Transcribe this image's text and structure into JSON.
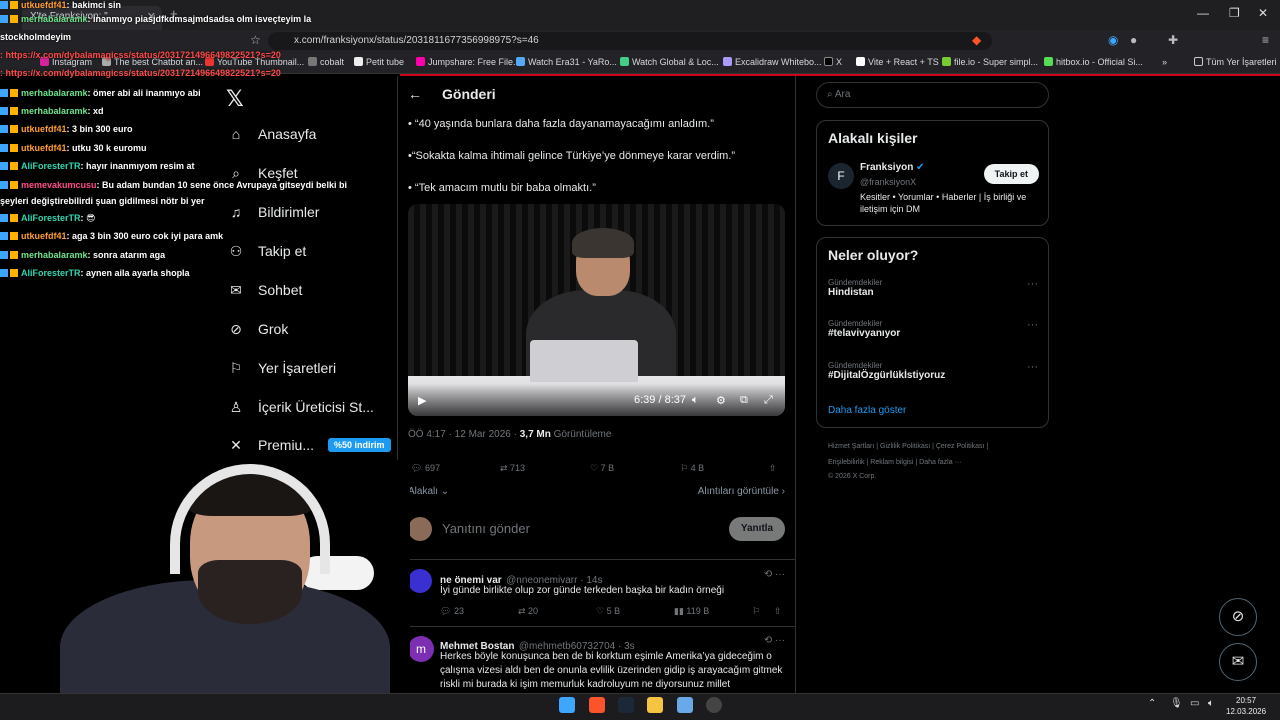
{
  "browser": {
    "tab_title": "X'te Franksiyon: \"",
    "tab_title2": "YouTuber Q",
    "url": "x.com/franksiyonx/status/2031811677356998975?s=46",
    "bookmarks": [
      "Instagram",
      "The best Chatbot an...",
      "YouTube Thumbnail...",
      "cobalt",
      "Petit tube",
      "Jumpshare: Free File...",
      "Watch Era31 - YaRo...",
      "Watch Global & Loc...",
      "Excalidraw Whitebo...",
      "X",
      "Vite + React + TS",
      "file.io - Super simpl...",
      "hitbox.io - Official Si...",
      "Tüm Yer İşaretleri"
    ]
  },
  "sidebar": {
    "items": [
      {
        "label": "Anasayfa",
        "icon": "home-icon"
      },
      {
        "label": "Keşfet",
        "icon": "search-icon"
      },
      {
        "label": "Bildirimler",
        "icon": "bell-icon"
      },
      {
        "label": "Takip et",
        "icon": "person-add-icon"
      },
      {
        "label": "Sohbet",
        "icon": "mail-icon"
      },
      {
        "label": "Grok",
        "icon": "grok-icon"
      },
      {
        "label": "Yer İşaretleri",
        "icon": "bookmark-icon"
      },
      {
        "label": "İçerik Üreticisi St...",
        "icon": "creator-icon"
      },
      {
        "label": "Premiu...",
        "icon": "x-icon"
      }
    ],
    "premium_badge": "%50 indirim"
  },
  "post": {
    "header": "Gönderi",
    "bullets": [
      "• “40 yaşında bunlara daha fazla dayanamayacağımı anladım.”",
      "•“Sokakta kalma ihtimali gelince Türkiye’ye dönmeye karar verdim.”",
      "• “Tek amacım mutlu bir baba olmaktı.”"
    ],
    "video_time": "6:39 / 8:37",
    "timestamp": "ÖÖ 4:17 · 12 Mar 2026 ·",
    "views": "3,7 Mn",
    "views_label": "Görüntüleme",
    "replies": "697",
    "reposts": "713",
    "likes": "7 B",
    "bookmarks": "4 B",
    "sort": "Alakalı",
    "quotes": "Alıntıları görüntüle",
    "reply_placeholder": "Yanıtını gönder",
    "reply_button": "Yanıtla"
  },
  "replies": [
    {
      "name": "ne önemi var",
      "handle": "@nneonemivarr · 14s",
      "text": "İyi günde birlikte olup zor günde terkeden başka bir kadın örneği",
      "r": "23",
      "rt": "20",
      "l": "5 B",
      "v": "119 B"
    },
    {
      "name": "Mehmet Bostan",
      "handle": "@mehmetb60732704 · 3s",
      "text": "Herkes böyle konuşunca ben de bi korktum eşimle Amerika’ya gideceğim o çalışma vizesi aldı ben de onunla evlilik üzerinden gidip iş arayacağım gitmek riskli mi burada ki işim memurluk kadroluyum ne diyorsunuz millet",
      "avatar_letter": "m"
    }
  ],
  "right": {
    "search_placeholder": "Ara",
    "relevant_title": "Alakalı kişiler",
    "person_name": "Franksiyon",
    "person_handle": "@franksiyonX",
    "person_bio": "Kesitler • Yorumlar • Haberler | İş birliği ve iletişim için DM",
    "follow": "Takip et",
    "trends_title": "Neler oluyor?",
    "trends": [
      {
        "cat": "Gündemdekiler",
        "name": "Hindistan"
      },
      {
        "cat": "Gündemdekiler",
        "name": "#telavivyanıyor"
      },
      {
        "cat": "Gündemdekiler",
        "name": "#DijitalÖzgürlükİstiyoruz"
      }
    ],
    "show_more": "Daha fazla göster",
    "footer1": "Hizmet Şartları  |  Gizlilik Politikası  |  Çerez Politikası  |",
    "footer2": "Erişilebilirlik  |  Reklam bilgisi  |  Daha fazla ···",
    "footer3": "© 2026 X Corp."
  },
  "chat": [
    {
      "user": "utkuefdf41",
      "msg": ": bakimci sin",
      "color": "#ff9d2e"
    },
    {
      "user": "merhabalaramk",
      "msg": ": inanmıyo piasjdfkdmsajmdsadsa olm isveçteyim la",
      "color": "#6de38a"
    },
    {
      "user": "",
      "msg": "stockholmdeyim",
      "color": "#fff"
    },
    {
      "user": "",
      "msg": ": https://x.com/dybalamagicss/status/2031721496649822521?s=20",
      "color": "#ff4b4b"
    },
    {
      "user": "",
      "msg": ": https://x.com/dybalamagicss/status/2031721496649822521?s=20",
      "color": "#ff4b4b"
    },
    {
      "user": "merhabalaramk",
      "msg": ": ömer abi ali inanmıyo abi",
      "color": "#6de38a"
    },
    {
      "user": "merhabalaramk",
      "msg": ": xd",
      "color": "#6de38a"
    },
    {
      "user": "utkuefdf41",
      "msg": ": 3 bin 300 euro",
      "color": "#ff9d2e"
    },
    {
      "user": "utkuefdf41",
      "msg": ": utku 30 k euromu",
      "color": "#ff9d2e"
    },
    {
      "user": "AliForesterTR",
      "msg": ": hayır inanmıyom resim at",
      "color": "#2fd7b0"
    },
    {
      "user": "memevakumcusu",
      "msg": ": Bu adam bundan 10 sene önce Avrupaya gitseydi belki bi",
      "color": "#ff4b8b"
    },
    {
      "user": "",
      "msg": "şeyleri değiştirebilirdi şuan gidilmesi nötr bi yer",
      "color": "#fff"
    },
    {
      "user": "AliForesterTR",
      "msg": ": 😎",
      "color": "#2fd7b0"
    },
    {
      "user": "utkuefdf41",
      "msg": ": aga 3 bin 300 euro cok iyi para amk",
      "color": "#ff9d2e"
    },
    {
      "user": "merhabalaramk",
      "msg": ": sonra atarım aga",
      "color": "#6de38a"
    },
    {
      "user": "AliForesterTR",
      "msg": ": aynen aila ayarla shopla",
      "color": "#2fd7b0"
    }
  ],
  "clock": {
    "time": "20:57",
    "date": "12.03.2026"
  }
}
